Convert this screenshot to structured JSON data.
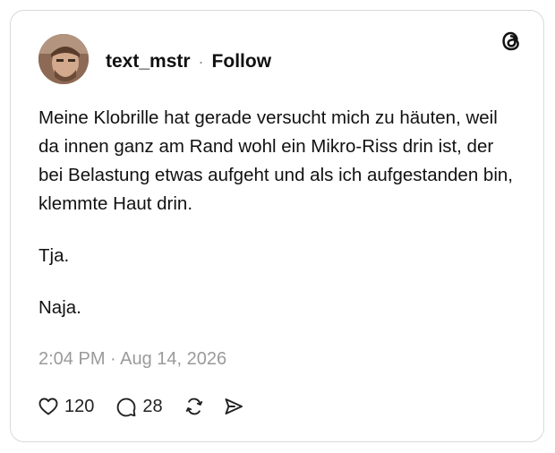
{
  "post": {
    "username": "text_mstr",
    "separator": "·",
    "follow_label": "Follow",
    "paragraphs": [
      "Meine Klobrille hat gerade versucht mich zu häuten, weil da innen ganz am Rand wohl ein Mikro-Riss drin ist, der bei Belastung etwas aufgeht und als ich aufgestanden bin, klemmte Haut drin.",
      "Tja.",
      "Naja."
    ],
    "timestamp": "2:04 PM · Aug 14, 2026"
  },
  "actions": {
    "likes": "120",
    "comments": "28"
  },
  "icons": {
    "logo": "threads-logo-icon",
    "like": "heart-icon",
    "comment": "comment-bubble-icon",
    "repost": "repost-icon",
    "share": "send-icon"
  },
  "colors": {
    "text": "#111111",
    "muted": "#9a9a9a",
    "border": "#d9d9d9"
  }
}
